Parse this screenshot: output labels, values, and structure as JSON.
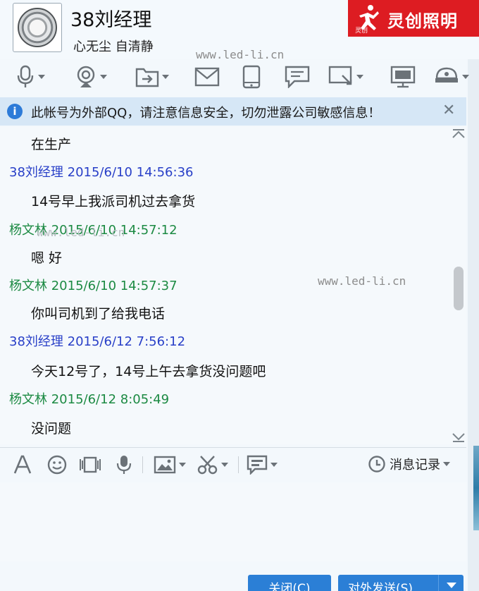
{
  "header": {
    "contact_name": "38刘经理",
    "signature": "心无尘 自清静",
    "watermark": "www.led-li.cn",
    "brand_text": "灵创照明",
    "brand_small": "灵创"
  },
  "toolbar": {
    "items": [
      {
        "icon": "microphone-icon"
      },
      {
        "icon": "video-call-icon"
      },
      {
        "icon": "file-transfer-icon"
      },
      {
        "icon": "mail-icon"
      },
      {
        "icon": "mobile-icon"
      },
      {
        "icon": "message-icon"
      },
      {
        "icon": "remote-assist-icon"
      },
      {
        "icon": "screen-share-icon"
      },
      {
        "icon": "app-icon"
      }
    ]
  },
  "notice": {
    "icon_label": "i",
    "text": "此帐号为外部QQ，请注意信息安全，切勿泄露公司敏感信息！",
    "close": "✕"
  },
  "messages": [
    {
      "type": "text",
      "text": "在生产"
    },
    {
      "type": "meta",
      "sender": "38刘经理 2015/6/10 14:56:36",
      "color": "#2940c8"
    },
    {
      "type": "text",
      "text": "14号早上我派司机过去拿货"
    },
    {
      "type": "meta",
      "sender": "杨文林 2015/6/10 14:57:12",
      "color": "#1c8a43"
    },
    {
      "type": "text",
      "text": "嗯  好"
    },
    {
      "type": "meta",
      "sender": "杨文林 2015/6/10 14:57:37",
      "color": "#1c8a43"
    },
    {
      "type": "text",
      "text": "你叫司机到了给我电话"
    },
    {
      "type": "meta",
      "sender": "38刘经理 2015/6/12 7:56:12",
      "color": "#2940c8"
    },
    {
      "type": "text",
      "text": "今天12号了，14号上午去拿货没问题吧"
    },
    {
      "type": "meta",
      "sender": "杨文林 2015/6/12 8:05:49",
      "color": "#1c8a43"
    },
    {
      "type": "text",
      "text": "没问题"
    }
  ],
  "input_toolbar": {
    "history_label": "消息记录"
  },
  "buttons": {
    "close_label": "关闭(C)",
    "send_label": "对外发送(S)"
  }
}
